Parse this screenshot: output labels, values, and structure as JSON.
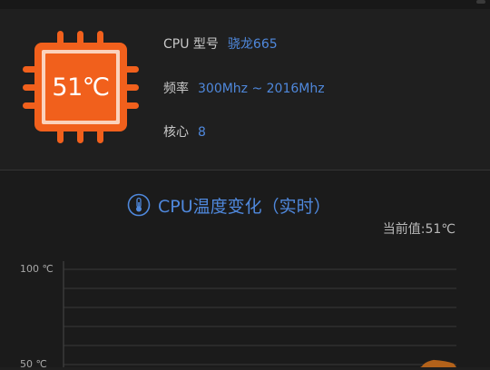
{
  "cpu": {
    "temperature_display": "51℃",
    "model_label": "CPU 型号",
    "model_value": "骁龙665",
    "frequency_label": "频率",
    "frequency_value": "300Mhz ~ 2016Mhz",
    "cores_label": "核心",
    "cores_value": "8"
  },
  "chart": {
    "title": "CPU温度变化（实时）",
    "current_value_text": "当前值:51℃"
  },
  "chart_data": {
    "type": "area",
    "title": "CPU温度变化（实时）",
    "xlabel": "",
    "ylabel": "",
    "y_tick_labels": [
      "100 ℃",
      "50 ℃"
    ],
    "ylim": [
      50,
      100
    ],
    "grid": true,
    "series": [
      {
        "values": [
          51
        ]
      }
    ]
  },
  "colors": {
    "chip_fill": "#f1601c",
    "chip_border": "#fbd2bc",
    "accent": "#4f88dc",
    "series_fill": "#b3621a",
    "background": "#1f1f1f"
  },
  "icons": {
    "chip": "cpu-chip-icon",
    "thermometer": "thermometer-icon"
  }
}
